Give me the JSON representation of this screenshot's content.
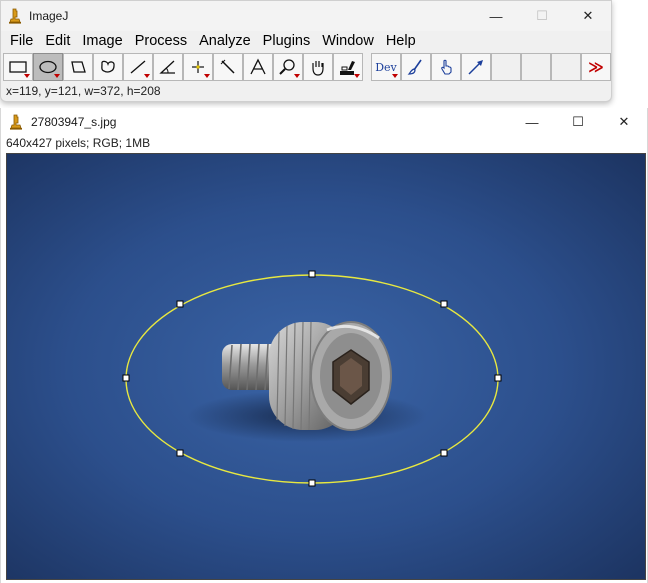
{
  "main_window": {
    "title": "ImageJ",
    "menus": [
      "File",
      "Edit",
      "Image",
      "Process",
      "Analyze",
      "Plugins",
      "Window",
      "Help"
    ],
    "status": "x=119, y=121, w=372, h=208",
    "dev_label": "Dev",
    "more_tools_glyph": "≫"
  },
  "image_window": {
    "title": "27803947_s.jpg",
    "info": "640x427 pixels; RGB; 1MB"
  },
  "icons": {
    "app": "microscope-icon",
    "minimize": "minimize-icon",
    "maximize": "maximize-icon",
    "close": "close-icon"
  },
  "colors": {
    "selection": "#e8e840",
    "background_blue": "#2b4d86",
    "more_tools": "#c00000"
  }
}
